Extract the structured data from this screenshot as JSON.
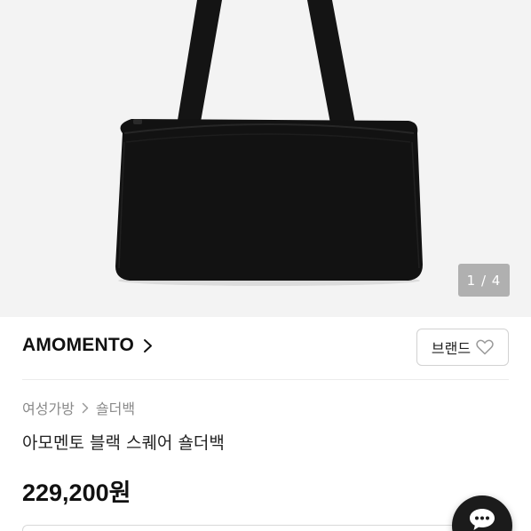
{
  "product_image": {
    "counter": "1 / 4",
    "alt_icon": "black-shoulder-bag-image"
  },
  "brand": {
    "name": "AMOMENTO",
    "chevron_icon": "chevron-right-icon",
    "button_label": "브랜드",
    "button_icon": "heart-outline-icon"
  },
  "breadcrumb": {
    "items": [
      "여성가방",
      "숄더백"
    ],
    "separator_icon": "chevron-right-icon"
  },
  "product": {
    "title": "아모멘토 블랙 스퀘어 숄더백",
    "price": "229,200원"
  },
  "chat_fab": {
    "icon": "chat-bubble-icon"
  },
  "colors": {
    "hero_bg": "#f3f3f3",
    "bag": "#111111",
    "fab": "#1b1b1b",
    "muted_text": "#8a8a8a"
  }
}
